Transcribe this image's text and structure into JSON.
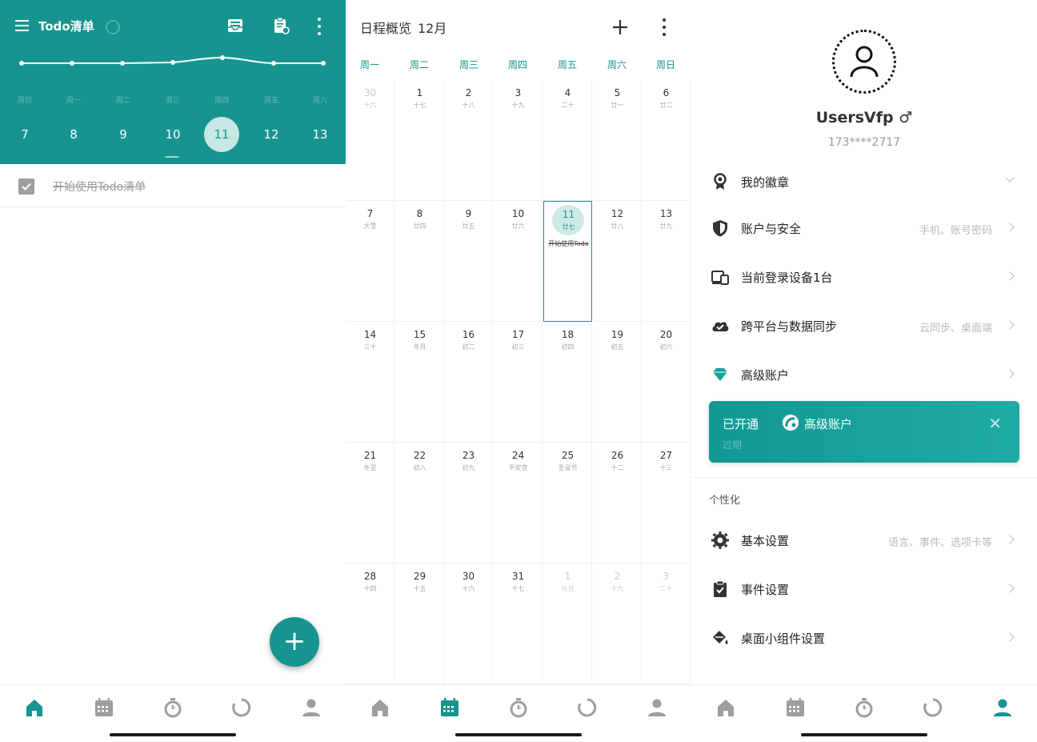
{
  "todo": {
    "title": "Todo清单",
    "week_labels": [
      "周日",
      "周一",
      "周二",
      "周三",
      "周四",
      "周五",
      "周六"
    ],
    "days": [
      "7",
      "8",
      "9",
      "10",
      "11",
      "12",
      "13"
    ],
    "selected_day": "11",
    "items": [
      {
        "text": "开始使用Todo清单",
        "done": true
      }
    ],
    "fab_label": "+"
  },
  "calendar": {
    "title": "日程概览",
    "month": "12月",
    "weekdays": [
      "周一",
      "周二",
      "周三",
      "周四",
      "周五",
      "周六",
      "周日"
    ],
    "weeks": [
      [
        {
          "n": "30",
          "l": "十六",
          "other": true
        },
        {
          "n": "1",
          "l": "十七"
        },
        {
          "n": "2",
          "l": "十八"
        },
        {
          "n": "3",
          "l": "十九"
        },
        {
          "n": "4",
          "l": "二十"
        },
        {
          "n": "5",
          "l": "廿一"
        },
        {
          "n": "6",
          "l": "廿二"
        }
      ],
      [
        {
          "n": "7",
          "l": "大雪"
        },
        {
          "n": "8",
          "l": "廿四"
        },
        {
          "n": "9",
          "l": "廿五"
        },
        {
          "n": "10",
          "l": "廿六"
        },
        {
          "n": "11",
          "l": "廿七",
          "today": true,
          "event": "开始使用Todo"
        },
        {
          "n": "12",
          "l": "廿八"
        },
        {
          "n": "13",
          "l": "廿九"
        }
      ],
      [
        {
          "n": "14",
          "l": "三十"
        },
        {
          "n": "15",
          "l": "冬月"
        },
        {
          "n": "16",
          "l": "初二"
        },
        {
          "n": "17",
          "l": "初三"
        },
        {
          "n": "18",
          "l": "初四"
        },
        {
          "n": "19",
          "l": "初五"
        },
        {
          "n": "20",
          "l": "初六"
        }
      ],
      [
        {
          "n": "21",
          "l": "冬至"
        },
        {
          "n": "22",
          "l": "初八"
        },
        {
          "n": "23",
          "l": "初九"
        },
        {
          "n": "24",
          "l": "平安夜"
        },
        {
          "n": "25",
          "l": "圣诞节"
        },
        {
          "n": "26",
          "l": "十二"
        },
        {
          "n": "27",
          "l": "十三"
        }
      ],
      [
        {
          "n": "28",
          "l": "十四"
        },
        {
          "n": "29",
          "l": "十五"
        },
        {
          "n": "30",
          "l": "十六"
        },
        {
          "n": "31",
          "l": "十七"
        },
        {
          "n": "1",
          "l": "元旦",
          "other": true
        },
        {
          "n": "2",
          "l": "十九",
          "other": true
        },
        {
          "n": "3",
          "l": "二十",
          "other": true
        }
      ]
    ]
  },
  "profile": {
    "username": "UsersVfp",
    "gender_symbol": "♂",
    "phone": "173****2717",
    "menu": [
      {
        "label": "我的徽章",
        "hint": "",
        "icon": "badge-icon"
      },
      {
        "label": "账户与安全",
        "hint": "手机、账号密码",
        "icon": "shield-icon"
      },
      {
        "label": "当前登录设备1台",
        "hint": "",
        "icon": "devices-icon"
      },
      {
        "label": "跨平台与数据同步",
        "hint": "云同步、桌面端",
        "icon": "cloud-sync-icon"
      },
      {
        "label": "高级账户",
        "hint": "",
        "icon": "diamond-icon"
      }
    ],
    "premium_card": {
      "prefix": "已开通",
      "name": "高级账户",
      "status": "过期",
      "close": "✕"
    },
    "section_personal": "个性化",
    "settings": [
      {
        "label": "基本设置",
        "hint": "语言、事件、选项卡等",
        "icon": "gear-icon"
      },
      {
        "label": "事件设置",
        "hint": "",
        "icon": "clipboard-check-icon"
      },
      {
        "label": "桌面小组件设置",
        "hint": "",
        "icon": "paint-bucket-icon"
      }
    ]
  },
  "colors": {
    "primary": "#17948f",
    "nav_inactive": "#9e9e9e",
    "selected_bg": "#c6e8e4"
  },
  "nav_items": [
    "home-icon",
    "calendar-icon",
    "timer-icon",
    "progress-ring-icon",
    "person-icon"
  ]
}
